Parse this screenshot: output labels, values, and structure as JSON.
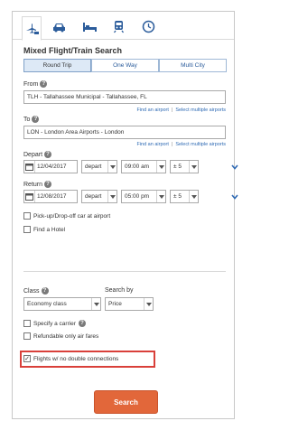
{
  "colors": {
    "accent_blue": "#2e6ab4",
    "search_button": "#e2673a",
    "highlight_border": "#d9403a"
  },
  "tabs": [
    {
      "icon": "flight-hotel-icon",
      "active": true
    },
    {
      "icon": "car-icon",
      "active": false
    },
    {
      "icon": "hotel-bed-icon",
      "active": false
    },
    {
      "icon": "train-icon",
      "active": false
    },
    {
      "icon": "clock-icon",
      "active": false
    }
  ],
  "heading": "Mixed Flight/Train Search",
  "trip_type": {
    "options": [
      "Round Trip",
      "One Way",
      "Multi City"
    ],
    "selected": "Round Trip"
  },
  "from": {
    "label": "From",
    "value": "TLH - Tallahassee Municipal - Tallahassee, FL",
    "find_link": "Find an airport",
    "multi_link": "Select multiple airports"
  },
  "to": {
    "label": "To",
    "value": "LON - London Area Airports - London",
    "find_link": "Find an airport",
    "multi_link": "Select multiple airports"
  },
  "depart": {
    "label": "Depart",
    "date": "12/04/2017",
    "type": "depart",
    "time": "09:00 am",
    "window": "± 5"
  },
  "return": {
    "label": "Return",
    "date": "12/08/2017",
    "type": "depart",
    "time": "05:00 pm",
    "window": "± 5"
  },
  "pickup_option": {
    "label": "Pick-up/Drop-off car at airport",
    "checked": false
  },
  "hotel_option": {
    "label": "Find a Hotel",
    "checked": false
  },
  "class": {
    "label": "Class",
    "value": "Economy class"
  },
  "search_by": {
    "label": "Search by",
    "value": "Price"
  },
  "carrier_option": {
    "label": "Specify a carrier",
    "checked": false
  },
  "refundable_option": {
    "label": "Refundable only air fares",
    "checked": false
  },
  "no_double_option": {
    "label": "Flights w/ no double connections",
    "checked": true
  },
  "search_button": "Search"
}
